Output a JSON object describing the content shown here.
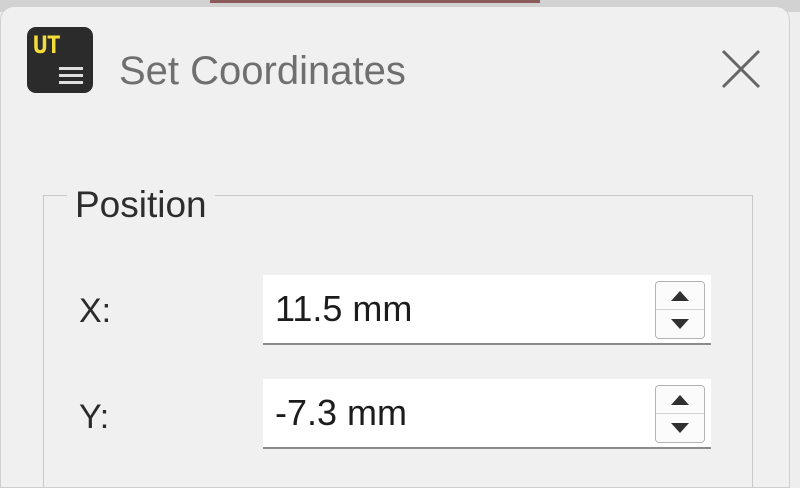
{
  "window": {
    "title": "Set Coordinates",
    "app_icon": {
      "name": "ut-app-icon",
      "text": "UT"
    },
    "close_icon": "close-icon"
  },
  "position_group": {
    "title": "Position",
    "x": {
      "label": "X:",
      "value": "11.5 mm"
    },
    "y": {
      "label": "Y:",
      "value": "-7.3 mm"
    }
  },
  "colors": {
    "window_background": "#f0f0f0",
    "icon_background": "#2b2b2b",
    "icon_text": "#f4dc3a",
    "field_background": "#ffffff"
  }
}
